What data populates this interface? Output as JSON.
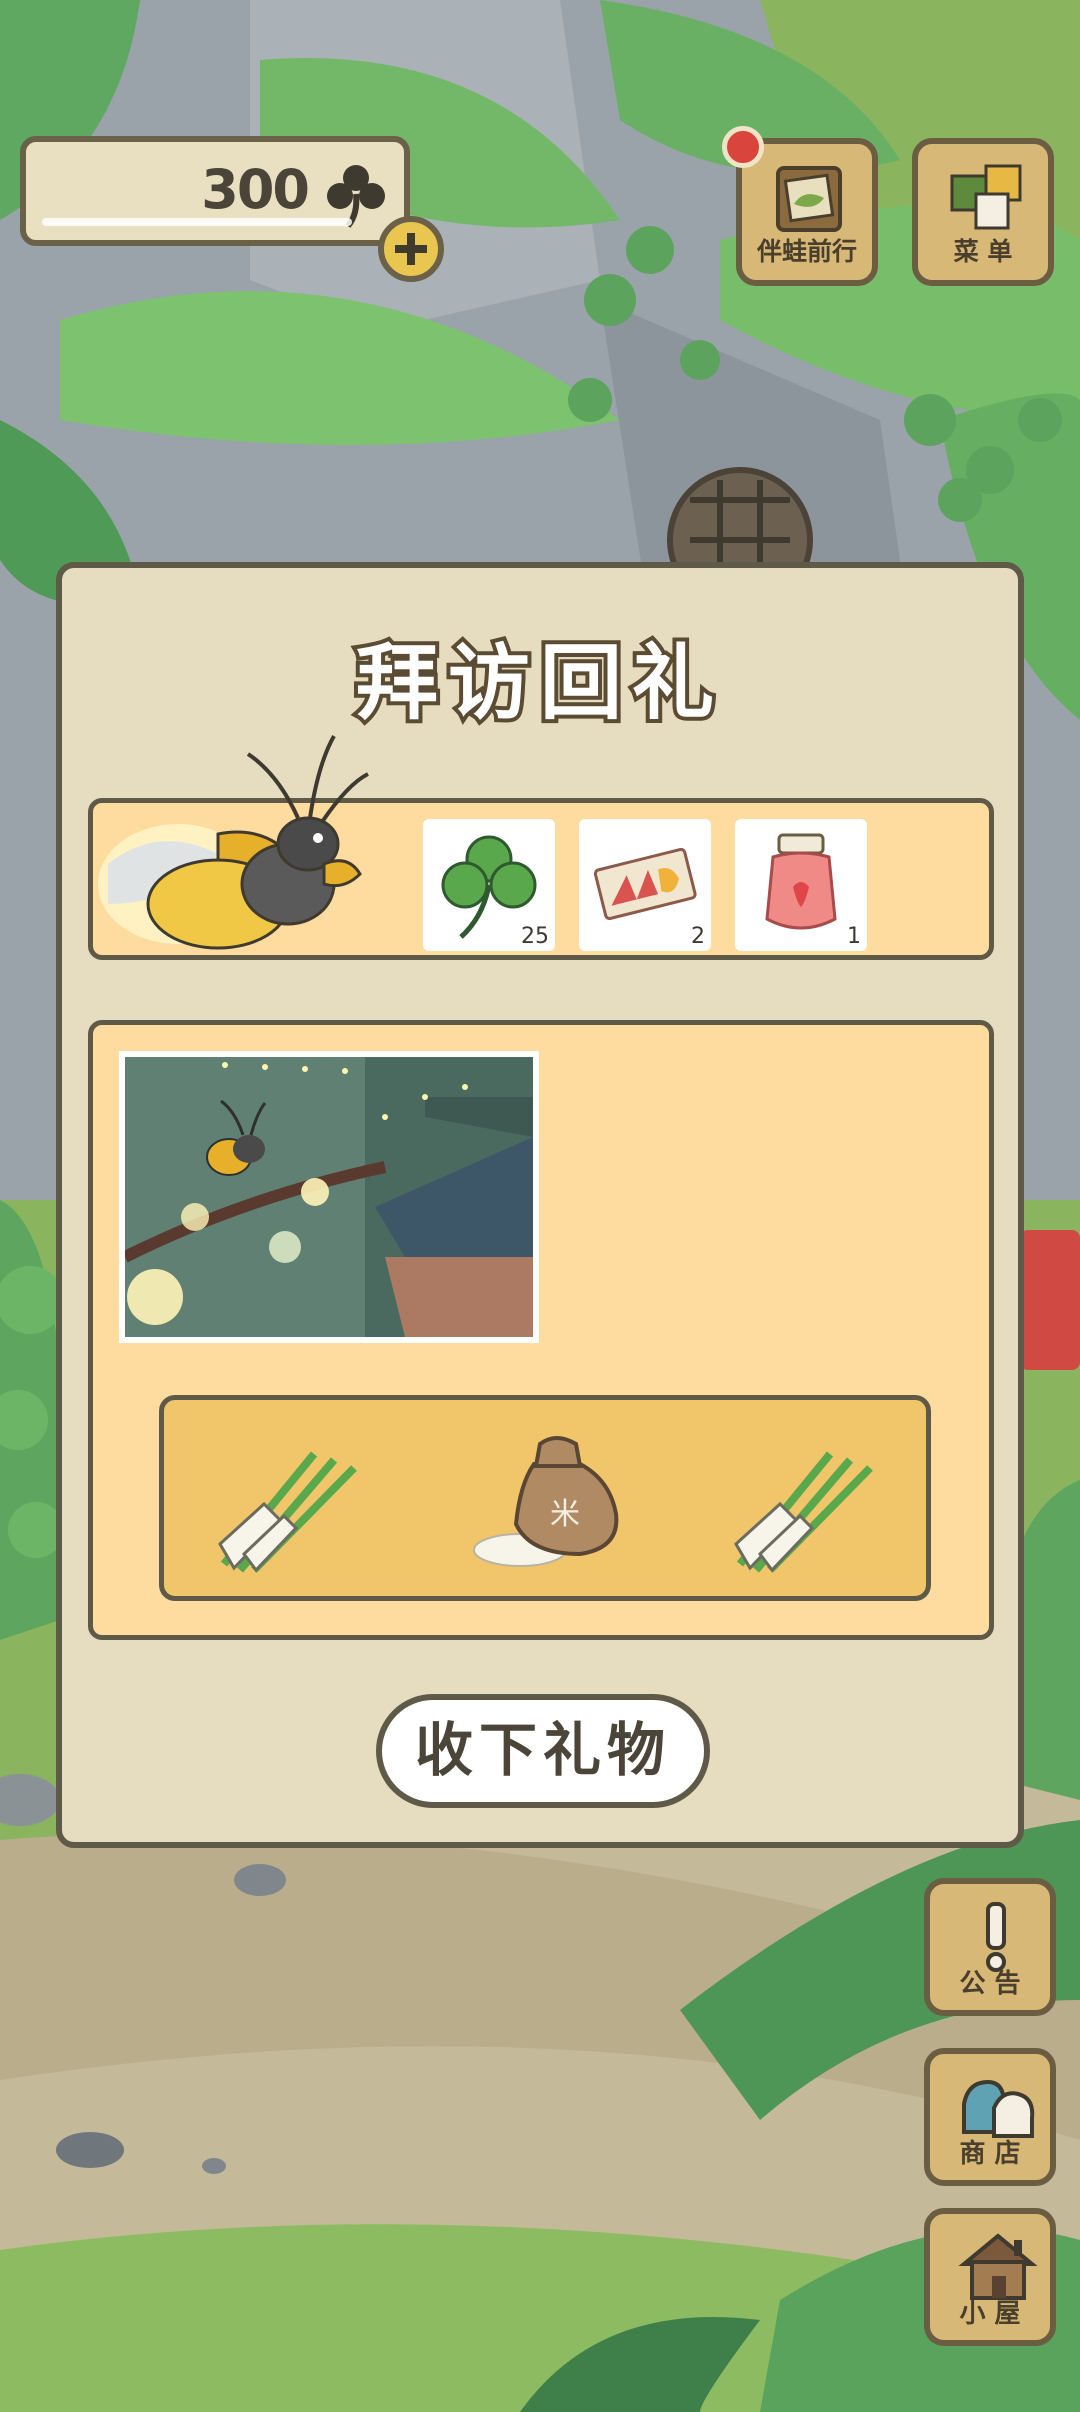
{
  "top_bar": {
    "clover_count": "300",
    "add_label": "+",
    "travel_button_label": "伴蛙前行",
    "menu_button_label": "菜 单",
    "has_notification": true
  },
  "side_buttons": [
    {
      "name": "announcement",
      "label": "公 告",
      "icon": "exclamation-icon"
    },
    {
      "name": "shop",
      "label": "商 店",
      "icon": "shop-bags-icon"
    },
    {
      "name": "house",
      "label": "小 屋",
      "icon": "house-icon"
    }
  ],
  "dialog": {
    "title": "拜访回礼",
    "visitor": "firefly",
    "rewards": [
      {
        "icon": "clover-icon",
        "count": "25"
      },
      {
        "icon": "ticket-icon",
        "count": "2"
      },
      {
        "icon": "strawberry-jam-icon",
        "count": "1"
      }
    ],
    "photo": "firefly-on-lantern-string",
    "gifts": [
      {
        "icon": "green-onion-icon"
      },
      {
        "icon": "rice-bag-icon",
        "text": "米"
      },
      {
        "icon": "green-onion-icon"
      }
    ],
    "accept_button_label": "收下礼物"
  },
  "colors": {
    "panel": "#fedb9e",
    "dialog": "#e6dcc0",
    "border": "#5f5a48",
    "gift_box": "#f1c56a",
    "wood_button": "#d8b877"
  }
}
